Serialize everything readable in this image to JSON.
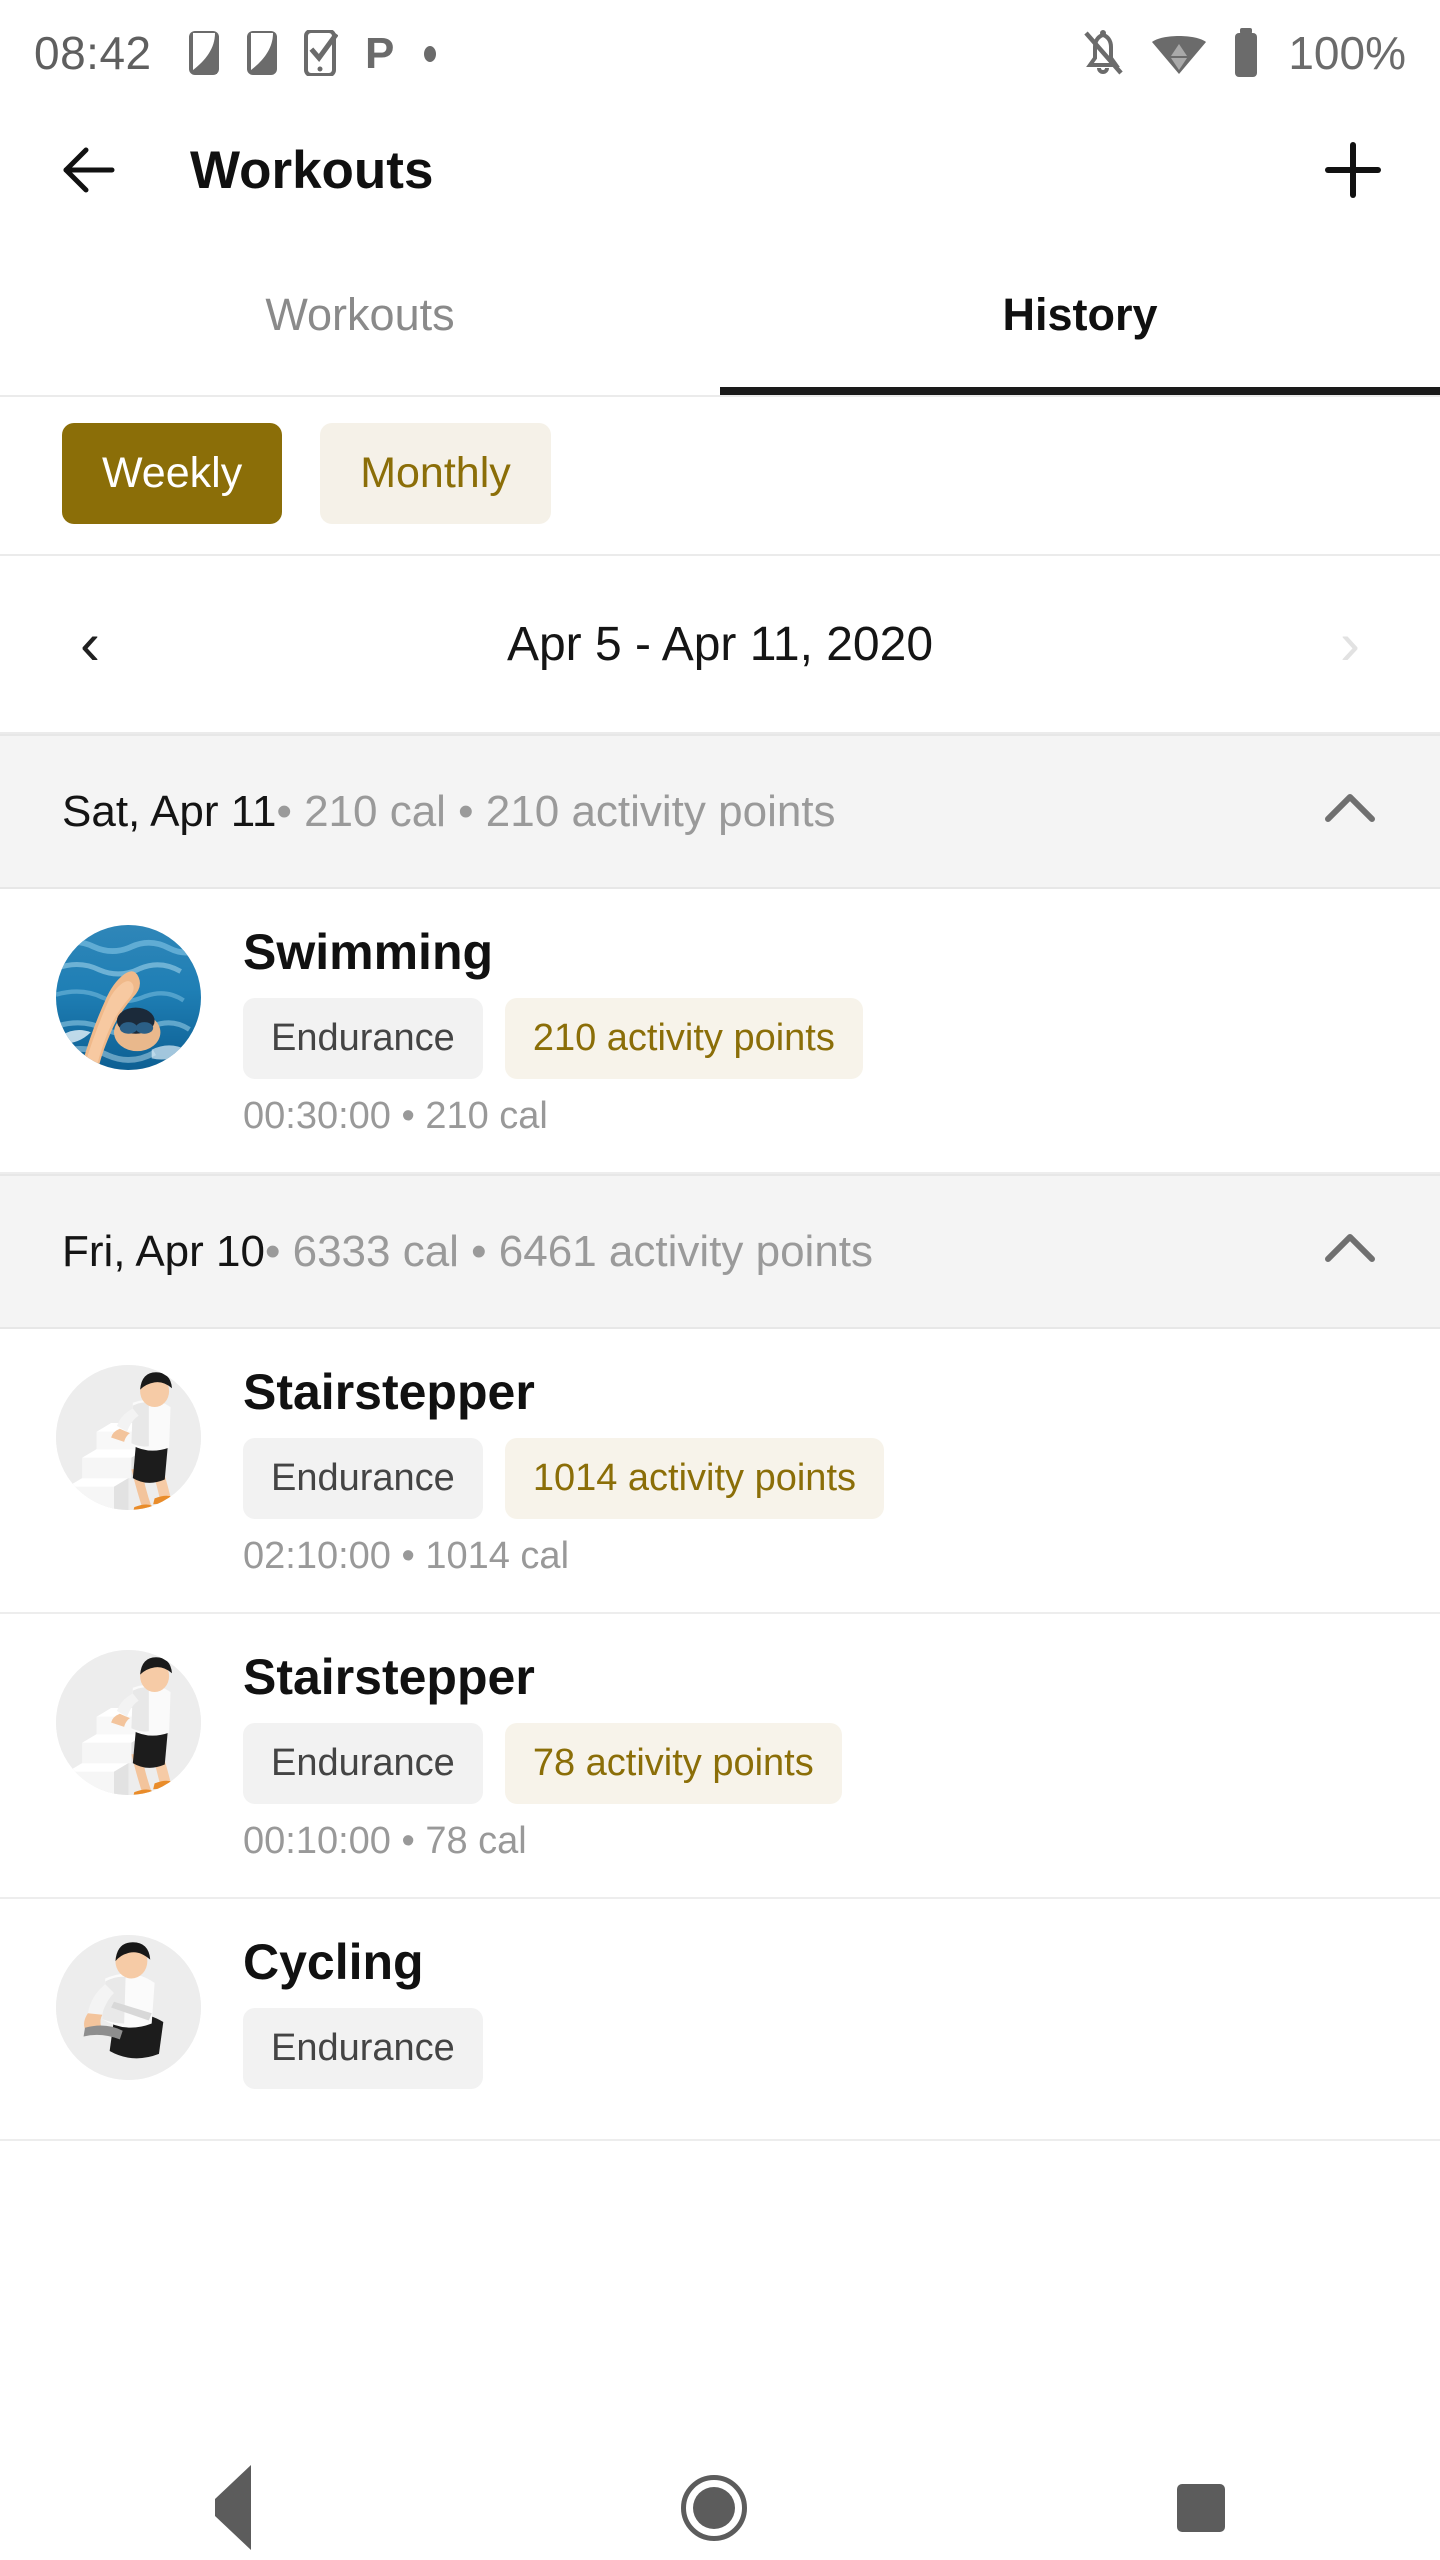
{
  "statusbar": {
    "time": "08:42",
    "battery_text": "100%",
    "left_icons": [
      "sim-card-icon",
      "sim-card-icon",
      "task-check-icon",
      "parking-p-icon",
      "dot-icon"
    ],
    "right_icons": [
      "notifications-off-icon",
      "wifi-icon",
      "battery-full-icon"
    ]
  },
  "appbar": {
    "back_icon": "arrow-left-icon",
    "title": "Workouts",
    "add_icon": "plus-icon"
  },
  "tabs": [
    {
      "label": "Workouts",
      "active": false
    },
    {
      "label": "History",
      "active": true
    }
  ],
  "filters": {
    "chips": [
      {
        "label": "Weekly",
        "selected": true
      },
      {
        "label": "Monthly",
        "selected": false
      }
    ],
    "selected_color": "#8b6e08",
    "unselected_bg": "#f5f1e8"
  },
  "date_nav": {
    "prev_icon": "chevron-left-icon",
    "next_icon": "chevron-right-icon",
    "range": "Apr 5 - Apr 11, 2020",
    "prev_enabled": true,
    "next_enabled": false
  },
  "days": [
    {
      "date": "Sat, Apr 11",
      "meta": " • 210 cal • 210 activity points",
      "expanded": true,
      "caret_icon": "chevron-up-icon",
      "workouts": [
        {
          "name": "Swimming",
          "type_badge": "Endurance",
          "points_badge": "210 activity points",
          "sub": "00:30:00 • 210 cal",
          "art": "swimming-photo"
        }
      ]
    },
    {
      "date": "Fri, Apr 10",
      "meta": " • 6333 cal • 6461 activity points",
      "expanded": true,
      "caret_icon": "chevron-up-icon",
      "workouts": [
        {
          "name": "Stairstepper",
          "type_badge": "Endurance",
          "points_badge": "1014 activity points",
          "sub": "02:10:00 • 1014 cal",
          "art": "stairstepper-photo"
        },
        {
          "name": "Stairstepper",
          "type_badge": "Endurance",
          "points_badge": "78 activity points",
          "sub": "00:10:00 • 78 cal",
          "art": "stairstepper-photo"
        },
        {
          "name": "Cycling",
          "type_badge": "Endurance",
          "points_badge": "",
          "sub": "",
          "art": "cycling-photo"
        }
      ]
    }
  ],
  "navbar": {
    "back_label": "back-button",
    "home_label": "home-button",
    "recents_label": "recents-button"
  }
}
